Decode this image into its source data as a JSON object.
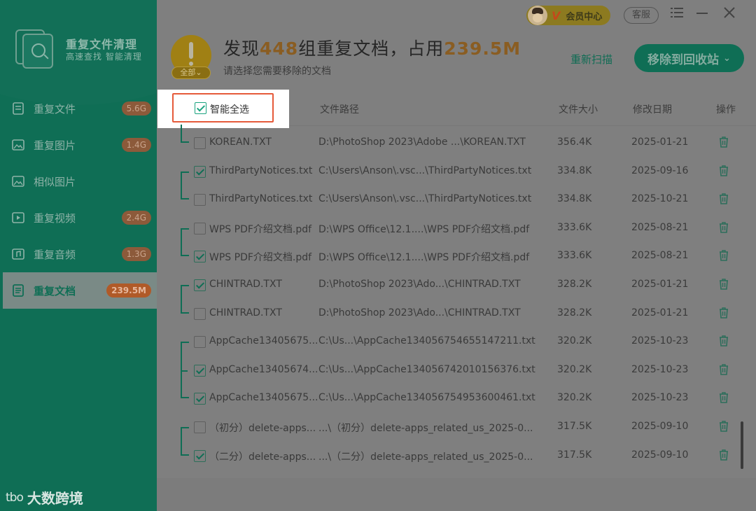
{
  "app": {
    "title": "重复文件清理",
    "subtitle": "高速查找 智能清理",
    "brand_mark": "tbo",
    "brand_name": "大数跨境"
  },
  "sidebar": {
    "items": [
      {
        "label": "重复文件",
        "badge": "5.6G",
        "icon": "file-icon",
        "active": false
      },
      {
        "label": "重复图片",
        "badge": "1.4G",
        "icon": "image-icon",
        "active": false
      },
      {
        "label": "相似图片",
        "badge": "",
        "icon": "image-icon",
        "active": false
      },
      {
        "label": "重复视频",
        "badge": "2.4G",
        "icon": "video-icon",
        "active": false
      },
      {
        "label": "重复音频",
        "badge": "1.3G",
        "icon": "audio-icon",
        "active": false
      },
      {
        "label": "重复文档",
        "badge": "239.5M",
        "icon": "document-icon",
        "active": true
      }
    ]
  },
  "topbar": {
    "vip_label": "会员中心",
    "vip_mark": "V",
    "service_label": "客服",
    "menu_icon": "menu-icon",
    "minimize_icon": "minimize-icon",
    "close_icon": "close-icon"
  },
  "header": {
    "prefix": "发现",
    "groups": "448",
    "middle": "组重复文档，占用",
    "size": "239.5M",
    "subtitle": "请选择您需要移除的文档",
    "all_label": "全部",
    "rescan_label": "重新扫描",
    "move_label": "移除到回收站"
  },
  "table": {
    "smart_select_label": "智能全选",
    "columns": {
      "path": "文件路径",
      "size": "文件大小",
      "date": "修改日期",
      "action": "操作"
    },
    "rows": [
      {
        "name": "KOREAN.TXT",
        "path": "D:\\PhotoShop 2023\\Adobe ...\\KOREAN.TXT",
        "size": "356.4K",
        "date": "2025-01-21",
        "checked": false
      },
      {
        "name": "ThirdPartyNotices.txt",
        "path": "C:\\Users\\Anson\\.vsc...\\ThirdPartyNotices.txt",
        "size": "334.8K",
        "date": "2025-09-16",
        "checked": true
      },
      {
        "name": "ThirdPartyNotices.txt",
        "path": "C:\\Users\\Anson\\.vsc...\\ThirdPartyNotices.txt",
        "size": "334.8K",
        "date": "2025-10-21",
        "checked": false
      },
      {
        "name": "WPS PDF介绍文档.pdf",
        "path": "D:\\WPS Office\\12.1....\\WPS PDF介绍文档.pdf",
        "size": "333.6K",
        "date": "2025-08-21",
        "checked": false
      },
      {
        "name": "WPS PDF介绍文档.pdf",
        "path": "D:\\WPS Office\\12.1....\\WPS PDF介绍文档.pdf",
        "size": "333.6K",
        "date": "2025-08-21",
        "checked": true
      },
      {
        "name": "CHINTRAD.TXT",
        "path": "D:\\PhotoShop 2023\\Ado...\\CHINTRAD.TXT",
        "size": "328.2K",
        "date": "2025-01-21",
        "checked": true
      },
      {
        "name": "CHINTRAD.TXT",
        "path": "D:\\PhotoShop 2023\\Ado...\\CHINTRAD.TXT",
        "size": "328.2K",
        "date": "2025-01-21",
        "checked": false
      },
      {
        "name": "AppCache13405675...",
        "path": "C:\\Us...\\AppCache134056754655147211.txt",
        "size": "320.2K",
        "date": "2025-10-23",
        "checked": false
      },
      {
        "name": "AppCache13405674...",
        "path": "C:\\Us...\\AppCache134056742010156376.txt",
        "size": "320.2K",
        "date": "2025-10-23",
        "checked": true
      },
      {
        "name": "AppCache13405675...",
        "path": "C:\\Us...\\AppCache134056754953600461.txt",
        "size": "320.2K",
        "date": "2025-10-23",
        "checked": true
      },
      {
        "name": "（初分）delete-apps...",
        "path": "...\\（初分）delete-apps_related_us_2025-0...",
        "size": "317.5K",
        "date": "2025-09-10",
        "checked": false
      },
      {
        "name": "（二分）delete-apps...",
        "path": "...\\（二分）delete-apps_related_us_2025-0...",
        "size": "317.5K",
        "date": "2025-09-10",
        "checked": true
      }
    ]
  },
  "colors": {
    "brand_green": "#0f6e55",
    "accent_orange": "#8a5d22",
    "highlight_red": "#e55a3a"
  }
}
